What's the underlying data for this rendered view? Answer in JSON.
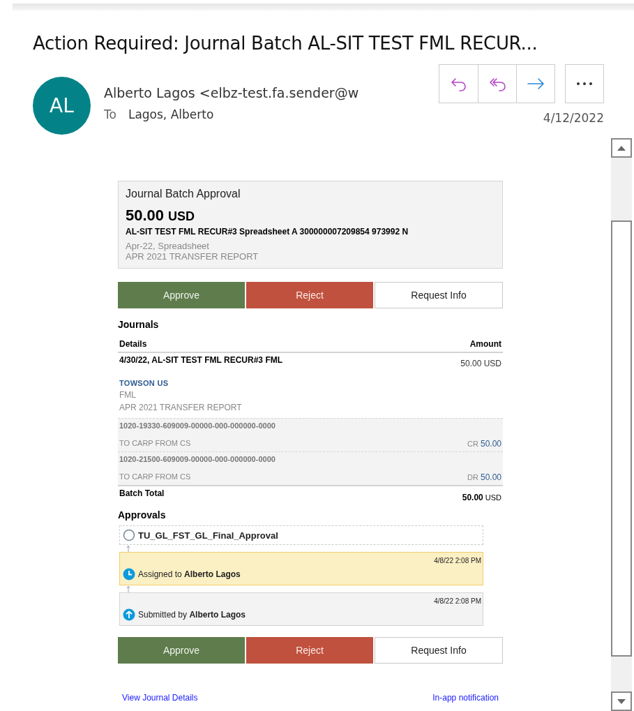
{
  "email": {
    "subject": "Action Required: Journal Batch AL-SIT TEST FML RECUR...",
    "sender": {
      "initials": "AL",
      "name": "Alberto Lagos <elbz-test.fa.sender@w"
    },
    "to_label": "To",
    "recipient": "Lagos, Alberto",
    "date": "4/12/2022"
  },
  "toolbar": [
    {
      "kind": "reply"
    },
    {
      "kind": "reply_all"
    },
    {
      "kind": "forward"
    },
    {
      "kind": "more"
    }
  ],
  "card": {
    "title": "Journal Batch Approval",
    "amount": "50.00",
    "currency": "USD",
    "reference": "AL-SIT TEST FML RECUR#3 Spreadsheet A 300000007209854 973992 N",
    "lines": [
      "Apr-22, Spreadsheet",
      "APR 2021 TRANSFER REPORT"
    ]
  },
  "actions_top": [
    {
      "kind": "approve",
      "label": "Approve"
    },
    {
      "kind": "reject",
      "label": "Reject"
    },
    {
      "kind": "info",
      "label": "Request Info"
    }
  ],
  "journals": {
    "heading": "Journals",
    "columns": [
      "Details",
      "Amount"
    ],
    "entry": {
      "title": "4/30/22, AL-SIT TEST FML RECUR#3 FML",
      "amount": "50.00 USD",
      "ledger": "TOWSON US",
      "category": "FML",
      "description": "APR 2021 TRANSFER REPORT"
    },
    "lines": [
      {
        "account": "1020-19330-609009-00000-000-000000-0000",
        "description": "TO CARP FROM CS",
        "side": "CR",
        "amount": "50.00"
      },
      {
        "account": "1020-21500-609009-00000-000-000000-0000",
        "description": "TO CARP FROM CS",
        "side": "DR",
        "amount": "50.00"
      }
    ],
    "total": {
      "label": "Batch Total",
      "amount": "50.00",
      "currency": "USD"
    }
  },
  "approvals": {
    "heading": "Approvals",
    "steps": [
      {
        "kind": "pending",
        "text": "TU_GL_FST_GL_Final_Approval"
      },
      {
        "kind": "assigned",
        "time": "4/8/22 2:08 PM",
        "text": "Assigned to **Alberto Lagos**"
      },
      {
        "kind": "submitted",
        "time": "4/8/22 2:08 PM",
        "text": "Submitted by **Alberto Lagos**"
      }
    ]
  },
  "actions_bottom": [
    {
      "kind": "approve",
      "label": "Approve"
    },
    {
      "kind": "reject",
      "label": "Reject"
    },
    {
      "kind": "info",
      "label": "Request Info"
    }
  ],
  "links": [
    "View Journal Details",
    "In-app notification"
  ]
}
